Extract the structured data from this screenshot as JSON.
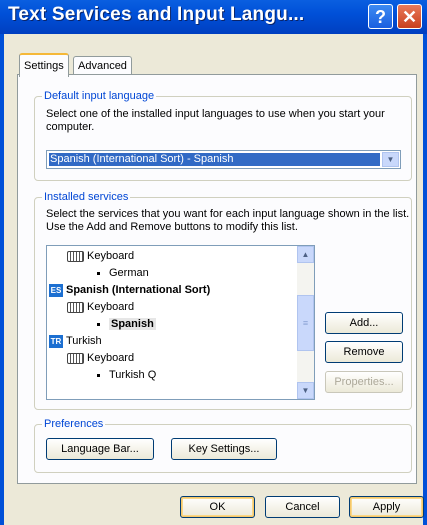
{
  "window": {
    "title": "Text Services and Input Langu...",
    "help_glyph": "?",
    "close_glyph": "✕"
  },
  "tabs": [
    {
      "label": "Settings",
      "active": true
    },
    {
      "label": "Advanced",
      "active": false
    }
  ],
  "default_input_language": {
    "legend": "Default input language",
    "description": "Select one of the installed input languages to use when you start your computer.",
    "selected_value": "Spanish (International Sort) - Spanish",
    "dropdown_glyph": "▼"
  },
  "installed_services": {
    "legend": "Installed services",
    "description": "Select the services that you want for each input language shown in the list. Use the Add and Remove buttons to modify this list.",
    "tree": [
      {
        "type": "category",
        "label": "Keyboard"
      },
      {
        "type": "layout",
        "label": "German"
      },
      {
        "type": "language",
        "code": "ES",
        "label": "Spanish (International Sort)"
      },
      {
        "type": "category",
        "label": "Keyboard"
      },
      {
        "type": "layout",
        "label": "Spanish",
        "selected": true
      },
      {
        "type": "language",
        "code": "TR",
        "label": "Turkish"
      },
      {
        "type": "category",
        "label": "Keyboard"
      },
      {
        "type": "layout",
        "label": "Turkish Q"
      }
    ],
    "scroll_up_glyph": "▲",
    "scroll_down_glyph": "▼",
    "scroll_grip_glyph": "≡",
    "buttons": {
      "add": "Add...",
      "remove": "Remove",
      "properties": "Properties..."
    }
  },
  "preferences": {
    "legend": "Preferences",
    "language_bar": "Language Bar...",
    "key_settings": "Key Settings..."
  },
  "footer": {
    "ok": "OK",
    "cancel": "Cancel",
    "apply": "Apply"
  }
}
